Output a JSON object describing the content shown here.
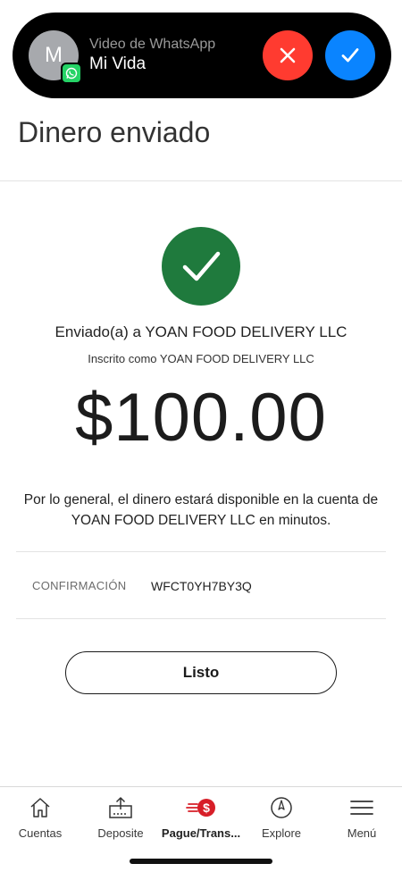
{
  "call": {
    "avatar_initial": "M",
    "subtitle": "Video de WhatsApp",
    "caller_name": "Mi Vida",
    "decline_icon": "x-icon",
    "accept_icon": "check-icon",
    "colors": {
      "decline": "#ff3b30",
      "accept": "#0a84ff",
      "whatsapp": "#25d366"
    }
  },
  "page": {
    "title": "Dinero enviado"
  },
  "receipt": {
    "success_icon": "check-circle-icon",
    "success_color": "#1f7a3d",
    "sent_to": "Enviado(a) a YOAN FOOD DELIVERY LLC",
    "registered_as": "Inscrito como YOAN FOOD DELIVERY LLC",
    "amount": "$100.00",
    "note": "Por lo general, el dinero estará disponible en la cuenta de YOAN FOOD DELIVERY LLC en minutos.",
    "confirmation_label": "CONFIRMACIÓN",
    "confirmation_value": "WFCT0YH7BY3Q",
    "done_label": "Listo"
  },
  "tabbar": {
    "items": [
      {
        "label": "Cuentas",
        "icon": "house-icon"
      },
      {
        "label": "Deposite",
        "icon": "deposit-upload-icon"
      },
      {
        "label": "Pague/Trans...",
        "icon": "pay-transfer-icon",
        "active": true
      },
      {
        "label": "Explore",
        "icon": "compass-icon"
      },
      {
        "label": "Menú",
        "icon": "hamburger-menu-icon"
      }
    ],
    "accent": "#d71e28"
  }
}
